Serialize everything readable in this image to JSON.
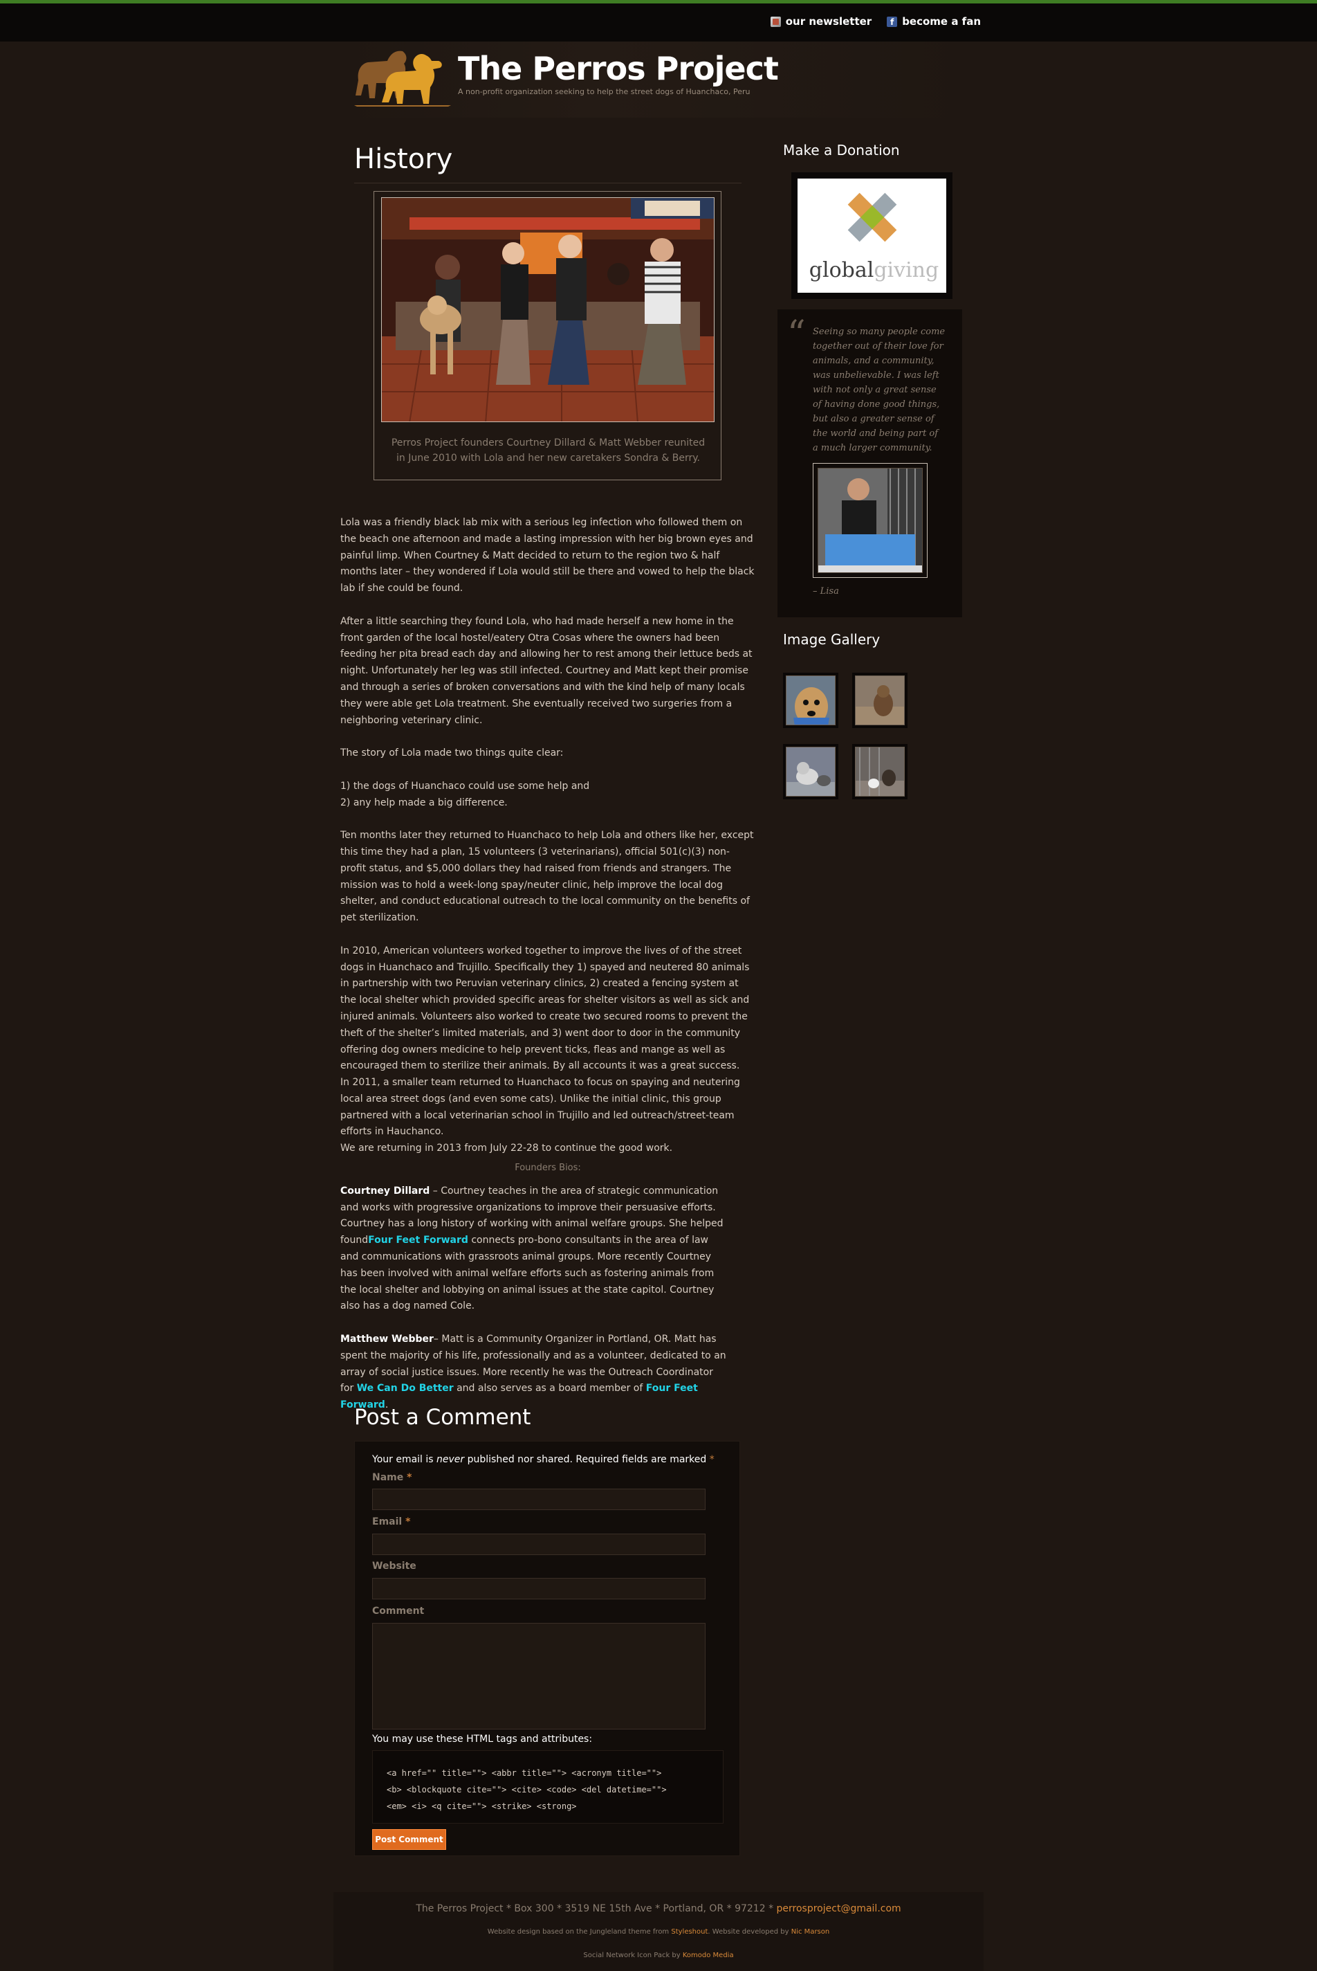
{
  "topnav": {
    "newsletter": "our newsletter",
    "fan": "become a fan"
  },
  "site": {
    "title": "The Perros Project",
    "tagline": "A non-profit organization seeking to help the street dogs of Huanchaco, Peru"
  },
  "page": {
    "title": "History",
    "photo_caption": "Perros Project founders Courtney Dillard & Matt Webber reunited in June 2010 with Lola and her new caretakers Sondra & Berry."
  },
  "content": {
    "p1": "Lola was a friendly black lab mix with a serious leg infection who followed them on the beach one afternoon and made a lasting impression with her big brown eyes and painful limp. When Courtney & Matt decided to return to the region two & half months later – they wondered if Lola would still be there and vowed to help the black lab if she could be found.",
    "p2": "After a little searching they found Lola, who had made herself a new home in the front garden of the local hostel/eatery Otra Cosas where the owners had been feeding her pita bread each day and allowing her to rest among their lettuce beds at night. Unfortunately her leg was still infected. Courtney and Matt kept their promise and through a series of broken conversations and with the kind help of many locals they were able get Lola treatment. She eventually received two surgeries from a neighboring veterinary clinic.",
    "p3": "The story of Lola made two things quite clear:",
    "list1": "1) the dogs of Huanchaco could use some help and",
    "list2": "2) any help made a big difference.",
    "p4": "Ten months later they returned to Huanchaco to help Lola and others like her, except this time they had a plan, 15 volunteers (3 veterinarians), official 501(c)(3) non-profit status, and $5,000 dollars they had raised from friends and strangers. The mission was to hold a week-long spay/neuter clinic, help improve the local dog shelter, and conduct educational outreach to the local community on the benefits of pet sterilization.",
    "p5": "In 2010, American volunteers worked together to improve the lives of of the street dogs in Huanchaco and Trujillo.  Specifically they 1)  spayed and neutered 80 animals in partnership with two Peruvian veterinary clinics, 2) created a fencing system at the local shelter which provided specific areas for shelter visitors as well as sick and injured animals.  Volunteers also worked to create two secured rooms to prevent the theft of the shelter’s limited materials, and 3) went door to door in the community offering dog owners medicine to help prevent ticks, fleas and mange as well as encouraged them to sterilize their animals.  By all accounts it was a great success.",
    "p6": "In 2011, a smaller team returned to Huanchaco to focus on spaying and neutering local area street dogs (and even some cats).  Unlike the initial clinic, this group partnered with a local veterinarian school in Trujillo and led outreach/street-team efforts in Hauchanco.",
    "p7": "We are returning in 2013 from July 22-28 to continue the good work.",
    "bios_heading": "Founders Bios:",
    "bio1_name": "Courtney Dillard",
    "bio1_a": " – Courtney teaches in the area of strategic communication and works with progressive organizations to improve their persuasive efforts. Courtney has a long history of working with animal welfare groups. She helped found",
    "bio1_link": "Four Feet Forward",
    "bio1_b": " connects pro-bono consultants in the area of law and communications with grassroots animal groups. More recently Courtney has been involved with animal welfare efforts such as fostering animals from the local shelter and lobbying on animal issues at the state capitol. Courtney also has a dog named Cole.",
    "bio2_name": "Matthew Webber",
    "bio2_a": "– Matt is a Community Organizer in Portland, OR. Matt has spent the majority of his life, professionally and as a volunteer, dedicated to an array of social justice issues. More recently he was the Outreach Coordinator for ",
    "bio2_link1": "We Can Do Better",
    "bio2_b": " and also serves as a board member of ",
    "bio2_link2": "Four Feet Forward",
    "bio2_c": "."
  },
  "comment": {
    "title": "Post a Comment",
    "note_a": "Your email is ",
    "note_em": "never",
    "note_b": " published nor shared. Required fields are marked ",
    "req": "*",
    "name_label": "Name",
    "email_label": "Email",
    "website_label": "Website",
    "comment_label": "Comment",
    "allowed_label": "You may use these HTML tags and attributes:",
    "allowed_tags": "<a href=\"\" title=\"\"> <abbr title=\"\"> <acronym title=\"\">\n<b> <blockquote cite=\"\"> <cite> <code> <del datetime=\"\">\n<em> <i> <q cite=\"\"> <strike> <strong>",
    "submit": "Post Comment"
  },
  "sidebar": {
    "donation_title": "Make a Donation",
    "gg_global": "global",
    "gg_giving": "giving",
    "quote": "Seeing so many people come together out of their love for animals, and a community, was unbelievable. I was left with not only a great sense of having done good things, but also a greater sense of the world and being part of a much larger community.",
    "quote_attr": "– Lisa",
    "gallery_title": "Image Gallery"
  },
  "footer": {
    "address": "The Perros Project * Box 300 * 3519 NE 15th Ave * Portland, OR * 97212 * ",
    "email": "perrosproject@gmail.com",
    "credit_a": "Website design based on the Jungleland theme from ",
    "credit_link1": "Styleshout",
    "credit_b": ". Website developed by ",
    "credit_link2": "Nic Marson",
    "icons_a": "Social Network Icon Pack by ",
    "icons_link": "Komodo Media"
  },
  "colors": {
    "accent": "#e06b1f",
    "link": "#22d3e6",
    "top_stripe": "#3f7d24"
  }
}
